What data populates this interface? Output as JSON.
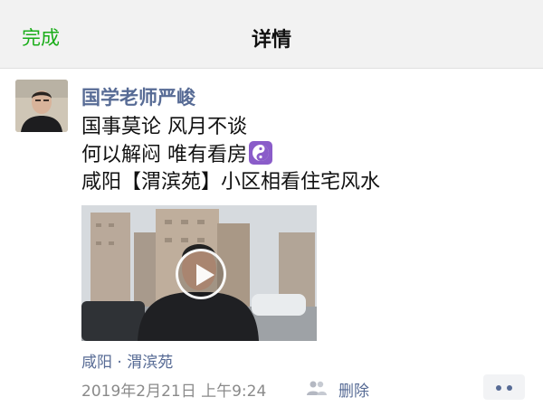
{
  "navbar": {
    "done_label": "完成",
    "title": "详情"
  },
  "post": {
    "author": "国学老师严峻",
    "lines": [
      "国事莫论 风月不谈",
      "何以解闷 唯有看房",
      "咸阳【渭滨苑】小区相看住宅风水"
    ],
    "emoji": "yin-yang-icon",
    "location": "咸阳 · 渭滨苑",
    "timestamp": "2019年2月21日 上午9:24",
    "delete_label": "删除"
  },
  "colors": {
    "accent_green": "#1aad19",
    "link_blue": "#576b95",
    "emoji_purple": "#8a5cc9"
  }
}
